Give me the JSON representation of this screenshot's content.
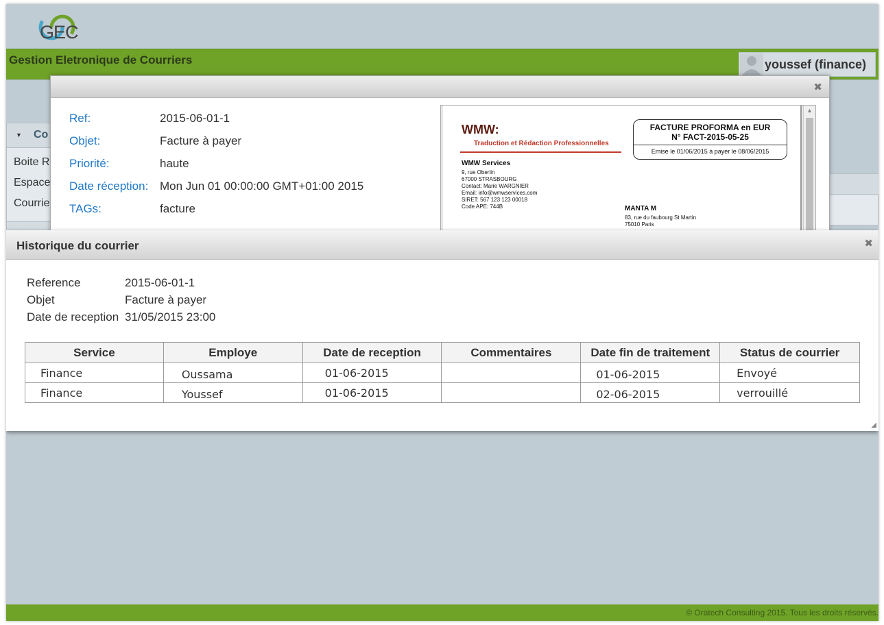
{
  "app": {
    "logo_text": "GEC",
    "title": "Gestion Eletronique de Courriers",
    "user": "youssef (finance)"
  },
  "sidebar": {
    "header": "Co",
    "items": [
      "Boite R",
      "Espace",
      "Courrie"
    ]
  },
  "detail": {
    "fields": [
      {
        "label": "Ref:",
        "value": "2015-06-01-1"
      },
      {
        "label": "Objet:",
        "value": "Facture à payer"
      },
      {
        "label": "Priorité:",
        "value": "haute"
      },
      {
        "label": "Date réception:",
        "value": "Mon Jun 01 00:00:00 GMT+01:00 2015"
      },
      {
        "label": "TAGs:",
        "value": "facture"
      }
    ],
    "document": {
      "brand": "WMW:",
      "tagline": "Traduction et Rédaction Professionnelles",
      "box_line1": "FACTURE PROFORMA en EUR",
      "box_line2": "N° FACT-2015-05-25",
      "box_line3": "Emise le 01/06/2015 à payer le 08/06/2015",
      "sender_name": "WMW Services",
      "sender_lines": [
        "9, rue Oberlin",
        "67000 STRASBOURG",
        "Contact: Marie WARGNIER",
        "Email: info@wmwservices.com",
        "SIRET: 567 123 123 00018",
        "Code APE: 744B"
      ],
      "recipient_name": "MANTA M",
      "recipient_lines": [
        "83, rue du faubourg St Martin",
        "75010 Paris"
      ]
    }
  },
  "history": {
    "title": "Historique du courrier",
    "info": [
      {
        "label": "Reference",
        "value": "2015-06-01-1"
      },
      {
        "label": "Objet",
        "value": "Facture à payer"
      },
      {
        "label": "Date de reception",
        "value": "31/05/2015 23:00"
      }
    ],
    "columns": [
      "Service",
      "Employe",
      "Date de reception",
      "Commentaires",
      "Date fin de traitement",
      "Status de courrier"
    ],
    "rows": [
      [
        "Finance",
        "Oussama",
        "01-06-2015",
        "",
        "01-06-2015",
        "Envoyé"
      ],
      [
        "Finance",
        "Youssef",
        "01-06-2015",
        "",
        "02-06-2015",
        "verrouillé"
      ]
    ]
  },
  "footer": {
    "text": "© Oratech Consulting 2015. Tous les droits réservés."
  },
  "colors": {
    "header_green": "#6fa328",
    "background": "#c0ccd4",
    "label_blue": "#1f78c8"
  }
}
